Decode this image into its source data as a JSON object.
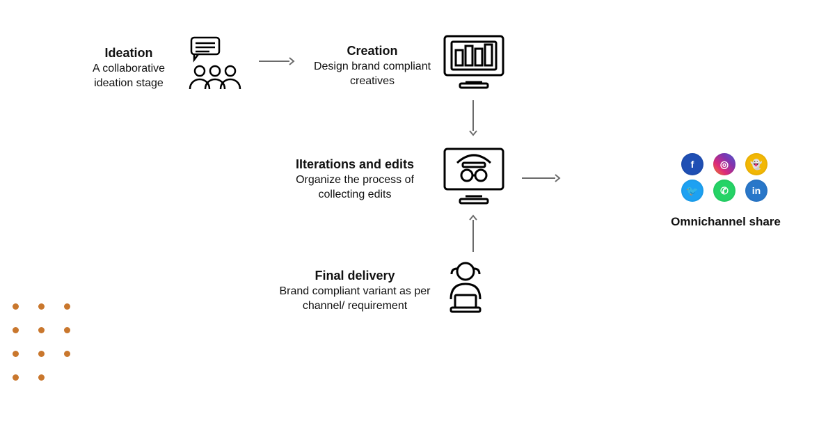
{
  "ideation": {
    "title": "Ideation",
    "desc": "A collaborative ideation stage"
  },
  "creation": {
    "title": "Creation",
    "desc": "Design brand compliant creatives"
  },
  "iterations": {
    "title": "IIterations and edits",
    "desc": "Organize the process of collecting edits"
  },
  "final": {
    "title": "Final delivery",
    "desc": "Brand compliant variant as per channel/ requirement"
  },
  "omnichannel": {
    "label": "Omnichannel share"
  },
  "social_icons": {
    "fb": "f",
    "ig": "◎",
    "sn": "👻",
    "tw": "🐦",
    "wa": "✆",
    "li": "in"
  }
}
